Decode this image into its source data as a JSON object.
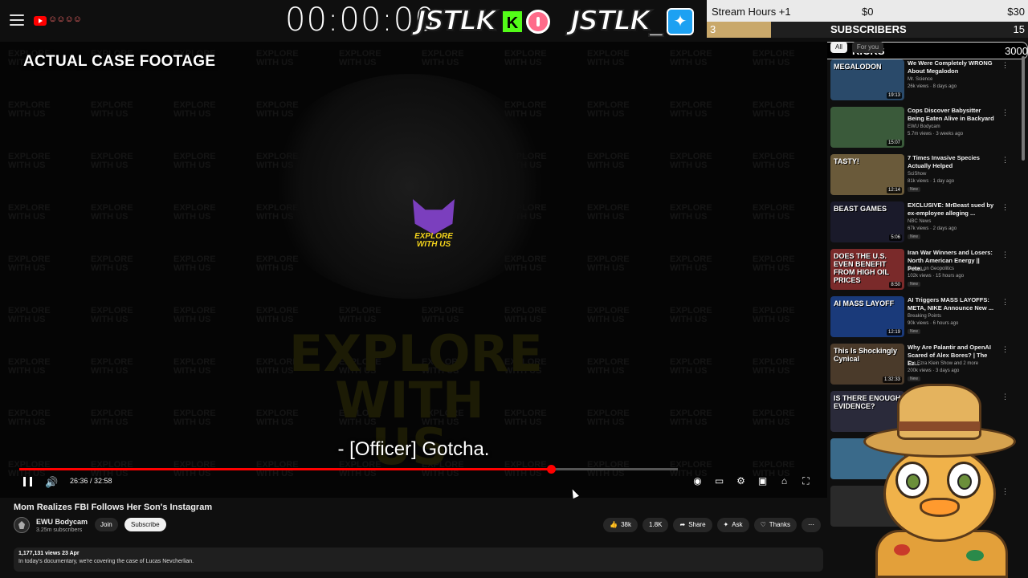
{
  "overlay": {
    "timer": "00:00:00",
    "brand_left": "JSTLK",
    "kick_letter": "K",
    "brand_right": "JSTLK_",
    "stream_hours_label": "Stream Hours +1",
    "stream_money_current": "$0",
    "stream_money_goal": "$30",
    "subscribers_label": "SUBSCRIBERS",
    "subscribers_current": "3",
    "subscribers_goal": "15",
    "kicks_label": "KICKS",
    "kicks_current": "0",
    "kicks_goal": "3000",
    "colors": {
      "kick_green": "#53fc18",
      "sub_fill": "#c9a86a",
      "twitter_blue": "#1da1f2"
    }
  },
  "youtube": {
    "chips": [
      "All",
      "For you"
    ],
    "player": {
      "case_title": "ACTUAL CASE FOOTAGE",
      "watermark_word": "EXPLORE WITH US",
      "logo_text": "EXPLORE WITH US",
      "caption": "- [Officer] Gotcha.",
      "time": "26:36 / 32:58",
      "progress_fraction": 0.807
    },
    "video": {
      "title": "Mom Realizes FBI Follows Her Son's Instagram",
      "channel": "EWU Bodycam",
      "subscribers": "3.25m subscribers",
      "join_label": "Join",
      "subscribe_label": "Subscribe",
      "likes": "38k",
      "dislikes": "1.8K",
      "share_label": "Share",
      "ask_label": "Ask",
      "thanks_label": "Thanks",
      "views_date": "1,177,131 views  23 Apr",
      "description": "In today's documentary, we're covering the case of Lucas Nevcherlian."
    },
    "recommendations": [
      {
        "title": "We Were Completely WRONG About Megalodon",
        "channel": "Mr. Science",
        "views": "26k views · 8 days ago",
        "duration": "19:13",
        "thumb_text": "MEGALODON",
        "color": "#2a4a6a",
        "new": false
      },
      {
        "title": "Cops Discover Babysitter Being Eaten Alive in Backyard",
        "channel": "EWU Bodycam",
        "views": "5.7m views · 3 weeks ago",
        "duration": "15:07",
        "thumb_text": "",
        "color": "#3a5a3a",
        "new": false
      },
      {
        "title": "7 Times Invasive Species Actually Helped",
        "channel": "SciShow",
        "views": "81k views · 1 day ago",
        "duration": "12:14",
        "thumb_text": "TASTY!",
        "color": "#6a5a3a",
        "new": true
      },
      {
        "title": "EXCLUSIVE: MrBeast sued by ex-employee alleging ...",
        "channel": "NBC News",
        "views": "67k views · 2 days ago",
        "duration": "5:06",
        "thumb_text": "BEAST GAMES",
        "color": "#1a1a2a",
        "new": true
      },
      {
        "title": "Iran War Winners and Losers: North American Energy || Pete...",
        "channel": "Zeihan on Geopolitics",
        "views": "102k views · 15 hours ago",
        "duration": "8:50",
        "thumb_text": "DOES THE U.S. EVEN BENEFIT FROM HIGH OIL PRICES",
        "color": "#7a2a2a",
        "new": true
      },
      {
        "title": "AI Triggers MASS LAYOFFS: META, NIKE Announce New ...",
        "channel": "Breaking Points",
        "views": "90k views · 6 hours ago",
        "duration": "12:19",
        "thumb_text": "AI MASS LAYOFF",
        "color": "#1a3a7a",
        "new": true
      },
      {
        "title": "Why Are Palantir and OpenAI Scared of Alex Bores? | The Ez...",
        "channel": "The Ezra Klein Show and 2 more",
        "views": "200k views · 3 days ago",
        "duration": "1:32:33",
        "thumb_text": "This Is Shockingly Cynical",
        "color": "#4a3a2a",
        "new": true
      },
      {
        "title": "",
        "channel": "",
        "views": "",
        "duration": "",
        "thumb_text": "IS THERE ENOUGH EVIDENCE?",
        "color": "#2a2a3a",
        "new": false
      },
      {
        "title": "",
        "channel": "",
        "views": "",
        "duration": "",
        "thumb_text": "",
        "color": "#3a6a8a",
        "new": false
      },
      {
        "title": "",
        "channel": "",
        "views": "",
        "duration": "",
        "thumb_text": "",
        "color": "#2a2a2a",
        "new": false
      }
    ]
  },
  "icons": {
    "menu": "hamburger-icon",
    "volume": "volume-icon",
    "pause": "pause-icon",
    "settings": "gear-icon",
    "like": "thumbs-up-icon",
    "share": "share-icon",
    "ask": "sparkle-icon",
    "thanks": "heart-icon",
    "more": "more-vert-icon"
  }
}
